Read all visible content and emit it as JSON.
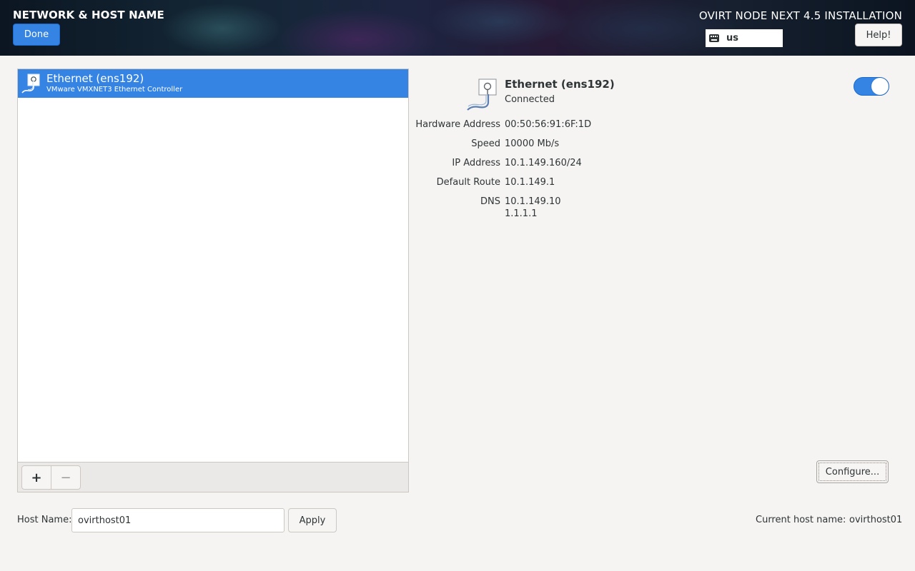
{
  "header": {
    "title": "NETWORK & HOST NAME",
    "done_label": "Done",
    "product": "OVIRT NODE NEXT 4.5 INSTALLATION",
    "keyboard_layout": "us",
    "help_label": "Help!"
  },
  "devices": [
    {
      "name": "Ethernet (ens192)",
      "description": "VMware VMXNET3 Ethernet Controller",
      "selected": true,
      "icon": "network-wired-icon"
    }
  ],
  "toolbar": {
    "add_label": "+",
    "remove_label": "−"
  },
  "details": {
    "name": "Ethernet (ens192)",
    "status": "Connected",
    "enabled": true,
    "properties": [
      {
        "label": "Hardware Address",
        "value": "00:50:56:91:6F:1D"
      },
      {
        "label": "Speed",
        "value": "10000 Mb/s"
      },
      {
        "label": "IP Address",
        "value": "10.1.149.160/24"
      },
      {
        "label": "Default Route",
        "value": "10.1.149.1"
      },
      {
        "label": "DNS",
        "value": "10.1.149.10",
        "value2": "1.1.1.1"
      }
    ],
    "configure_label": "Configure..."
  },
  "hostname": {
    "label": "Host Name:",
    "value": "ovirthost01",
    "apply_label": "Apply",
    "current_label": "Current host name:",
    "current_value": "ovirthost01"
  },
  "colors": {
    "accent": "#3584e4",
    "background": "#f5f4f2"
  }
}
